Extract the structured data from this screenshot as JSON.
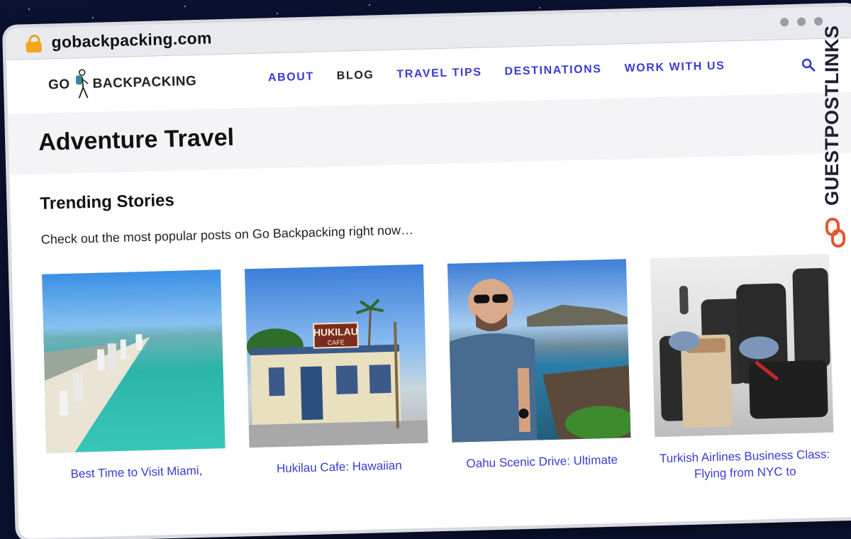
{
  "browser": {
    "url": "gobackpacking.com"
  },
  "site": {
    "logo_go": "GO",
    "logo_rest": "BACKPACKING",
    "menu": [
      {
        "label": "ABOUT"
      },
      {
        "label": "BLOG"
      },
      {
        "label": "TRAVEL TIPS"
      },
      {
        "label": "DESTINATIONS"
      },
      {
        "label": "WORK WITH US"
      }
    ],
    "accent_color": "#3a3bd4"
  },
  "page": {
    "title": "Adventure Travel",
    "section_title": "Trending Stories",
    "intro": "Check out the most popular posts on Go Backpacking right now…"
  },
  "cards": [
    {
      "title": "Best Time to Visit Miami,",
      "icon": "beach-photo"
    },
    {
      "title": "Hukilau Cafe: Hawaiian",
      "icon": "cafe-photo",
      "sign": "HUKILAU",
      "sign_sub": "CAFE"
    },
    {
      "title": "Oahu Scenic Drive: Ultimate",
      "icon": "coast-photo"
    },
    {
      "title": "Turkish Airlines Business Class: Flying from NYC to",
      "icon": "airplane-seat-photo"
    }
  ],
  "watermark": {
    "text": "GUESTPOSTLINKS"
  }
}
